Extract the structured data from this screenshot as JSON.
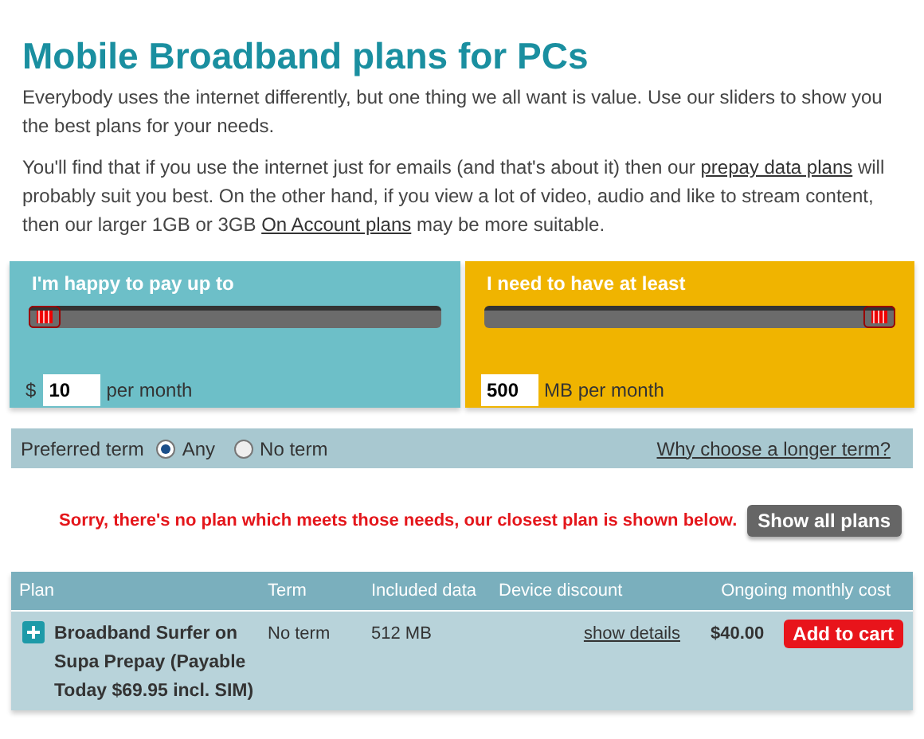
{
  "title": "Mobile Broadband plans for PCs",
  "paragraphs": [
    [
      {
        "kind": "text",
        "text": "Everybody uses the internet differently, but one thing we all want is value. Use our sliders to show you the best plans for your needs."
      }
    ],
    [
      {
        "kind": "text",
        "text": "You'll find that if you use the internet just for emails (and that's about it) then our "
      },
      {
        "kind": "link",
        "text": "prepay data plans"
      },
      {
        "kind": "text",
        "text": " will probably suit you best. On the other hand, if you view a lot of video, audio and like to stream content, then our larger 1GB or 3GB "
      },
      {
        "kind": "link",
        "text": "On Account plans"
      },
      {
        "kind": "text",
        "text": " may be more suitable."
      }
    ]
  ],
  "sliders": [
    {
      "label": "I'm happy to pay up to",
      "level": 0,
      "prefix": "$",
      "value": "10",
      "suffix": "per month",
      "color": "#6dbfc8"
    },
    {
      "label": "I need to have at least",
      "level": 1,
      "value": "500",
      "suffix": "MB per month",
      "color": "#f0b400"
    }
  ],
  "term": {
    "label": "Preferred term",
    "options": [
      {
        "label": "Any",
        "selected": true
      },
      {
        "label": "No term",
        "selected": false
      }
    ],
    "link": "Why choose a longer term?"
  },
  "message": "Sorry, there's no plan which meets those needs, our closest plan is shown below.",
  "show_all_button": "Show all plans",
  "table": {
    "columns": [
      "Plan",
      "Term",
      "Included data",
      "Device discount",
      "Ongoing monthly cost"
    ],
    "rows": [
      {
        "expanded": false,
        "plan": "Broadband Surfer on Supa Prepay (Payable Today $69.95 incl. SIM)",
        "term": "No term",
        "data": "512 MB",
        "discount": "show details",
        "cost": "$40.00",
        "action": "Add to cart"
      }
    ]
  }
}
